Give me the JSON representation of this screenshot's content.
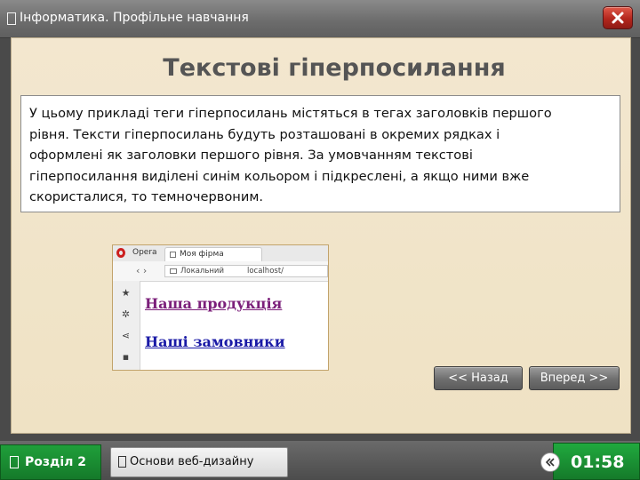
{
  "window": {
    "title": "Інформатика. Профільне навчання",
    "icon": "document-icon",
    "close_icon": "close-icon",
    "accent_color": "#c0281c"
  },
  "slide": {
    "title": "Текстові гіперпосилання",
    "paragraph_lines": [
      "У цьому прикладі теги гіперпосилань містяться в тегах заголовків першого",
      "рівня. Тексти гіперпосилань будуть розташовані в окремих рядках і",
      "оформлені як заголовки першого рівня. За умовчанням текстові",
      "гіперпосилання виділені синім кольором і підкреслені, а якщо ними вже",
      "скористалися, то темночервоним."
    ],
    "background_color": "#f2e5cb"
  },
  "browser_illustration": {
    "app_label": "Opera",
    "tab_title": "Моя фірма",
    "address_prefix": "Локальний",
    "address_host": "localhost/",
    "sidebar_icons": [
      "star-icon",
      "gear-icon",
      "share-icon",
      "bookmark-icon"
    ],
    "links": [
      {
        "text": "Наша продукція",
        "state": "visited",
        "color": "#7b1f7a"
      },
      {
        "text": "Наші замовники",
        "state": "unvisited",
        "color": "#1a1aa6"
      }
    ]
  },
  "navigation": {
    "back_label": "<< Назад",
    "forward_label": "Вперед >>"
  },
  "footer": {
    "section_label": "Розділ 2",
    "topic_label": "Основи веб-дизайну",
    "timer": "01:58",
    "timer_icon": "timer-toggle-icon",
    "accent_color": "#1b8f34"
  }
}
